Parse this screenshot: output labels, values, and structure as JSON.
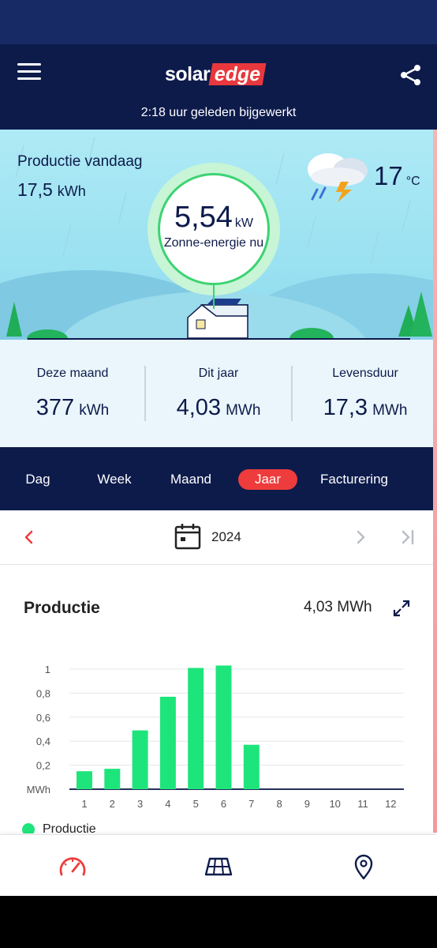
{
  "header": {
    "logo_solar": "solar",
    "logo_edge": "edge",
    "updated_text": "2:18 uur geleden bijgewerkt"
  },
  "hero": {
    "production_today_label": "Productie vandaag",
    "production_today_value": "17,5",
    "production_today_unit": "kWh",
    "power_value": "5,54",
    "power_unit": "kW",
    "power_label": "Zonne-energie nu",
    "weather_icon": "thunderstorm-rain-icon",
    "temperature": "17",
    "temperature_unit": "°C"
  },
  "totals": [
    {
      "label": "Deze maand",
      "value": "377",
      "unit": "kWh"
    },
    {
      "label": "Dit jaar",
      "value": "4,03",
      "unit": "MWh"
    },
    {
      "label": "Levensduur",
      "value": "17,3",
      "unit": "MWh"
    }
  ],
  "tabs": [
    {
      "label": "Dag",
      "active": false
    },
    {
      "label": "Week",
      "active": false
    },
    {
      "label": "Maand",
      "active": false
    },
    {
      "label": "Jaar",
      "active": true
    },
    {
      "label": "Facturering",
      "active": false
    }
  ],
  "date_nav": {
    "year": "2024"
  },
  "chart_card": {
    "title": "Productie",
    "total": "4,03 MWh"
  },
  "chart_data": {
    "type": "bar",
    "categories": [
      "1",
      "2",
      "3",
      "4",
      "5",
      "6",
      "7",
      "8",
      "9",
      "10",
      "11",
      "12"
    ],
    "series": [
      {
        "name": "Productie",
        "values": [
          0.15,
          0.17,
          0.49,
          0.77,
          1.01,
          1.03,
          0.37,
          0,
          0,
          0,
          0,
          0
        ]
      }
    ],
    "yticks": [
      "MWh",
      "0,2",
      "0,4",
      "0,6",
      "0,8",
      "1"
    ],
    "ylim": [
      0,
      1.1
    ],
    "ylabel": "MWh",
    "grid": true,
    "bar_color": "#1de57b",
    "legend_position": "bottom-left"
  },
  "colors": {
    "navy": "#0d1b4b",
    "accent_red": "#ee3b3b",
    "bar_green": "#1de57b"
  },
  "bottom_nav": [
    {
      "icon": "gauge-icon",
      "active": true
    },
    {
      "icon": "solar-panel-icon",
      "active": false
    },
    {
      "icon": "location-pin-icon",
      "active": false
    }
  ]
}
